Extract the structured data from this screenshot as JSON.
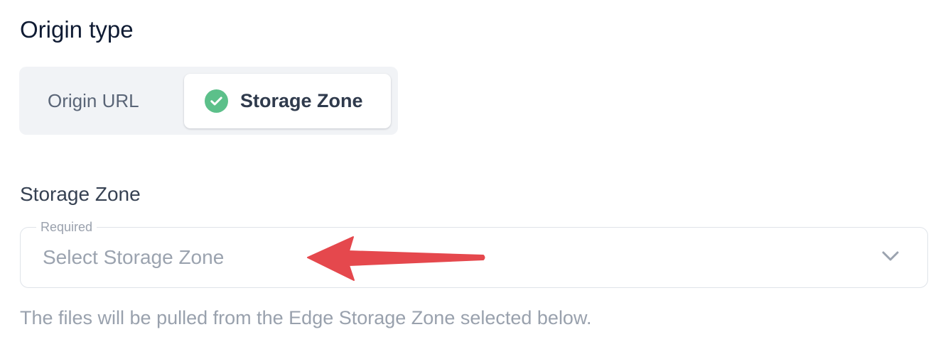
{
  "origin_type": {
    "title": "Origin type",
    "options": [
      {
        "label": "Origin URL",
        "selected": false
      },
      {
        "label": "Storage Zone",
        "selected": true
      }
    ]
  },
  "storage_zone": {
    "label": "Storage Zone",
    "required_label": "Required",
    "placeholder": "Select Storage Zone",
    "help_text": "The files will be pulled from the Edge Storage Zone selected below."
  },
  "icons": {
    "selected_option": "check-circle-icon",
    "dropdown": "chevron-down-icon",
    "annotation": "red-arrow-annotation"
  },
  "colors": {
    "check": "#5cc08a",
    "arrow": "#e5484d"
  }
}
